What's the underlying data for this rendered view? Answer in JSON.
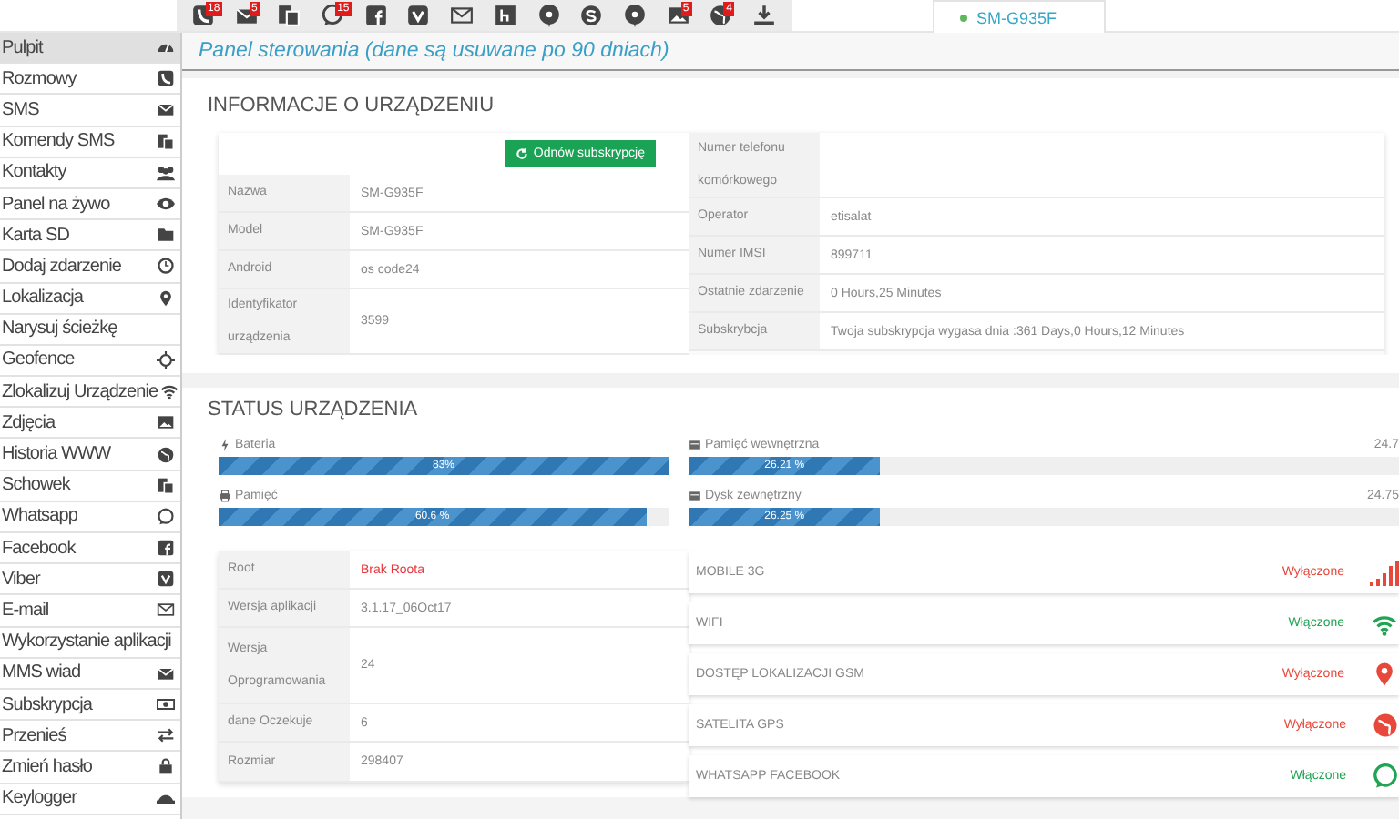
{
  "toolbar": {
    "buttons": [
      {
        "notified": true,
        "badge": "18"
      },
      {
        "notified": true,
        "badge": "5"
      },
      {
        "notified": false
      },
      {
        "notified": true,
        "badge": "15"
      },
      {
        "notified": false
      },
      {
        "notified": false
      },
      {
        "notified": false
      },
      {
        "notified": false
      },
      {
        "notified": false
      },
      {
        "notified": false
      },
      {
        "notified": false
      },
      {
        "notified": true,
        "badge": "5"
      },
      {
        "notified": true,
        "badge": "4"
      },
      {
        "notified": false
      }
    ]
  },
  "device_tab": {
    "label": "SM-G935F",
    "online": true
  },
  "sidebar": {
    "items": [
      {
        "label": "Pulpit",
        "selected": true
      },
      {
        "label": "Rozmowy",
        "selected": false
      },
      {
        "label": "SMS",
        "selected": false
      },
      {
        "label": "Komendy SMS",
        "selected": false
      },
      {
        "label": "Kontakty",
        "selected": false
      },
      {
        "label": "Panel na żywo",
        "selected": false
      },
      {
        "label": "Karta SD",
        "selected": false
      },
      {
        "label": "Dodaj zdarzenie",
        "selected": false
      },
      {
        "label": "Lokalizacja",
        "selected": false
      },
      {
        "label": "Narysuj ścieżkę",
        "selected": false
      },
      {
        "label": "Geofence",
        "selected": false
      },
      {
        "label": "Zlokalizuj Urządzenie",
        "selected": false
      },
      {
        "label": "Zdjęcia",
        "selected": false
      },
      {
        "label": "Historia WWW",
        "selected": false
      },
      {
        "label": "Schowek",
        "selected": false
      },
      {
        "label": "Whatsapp",
        "selected": false
      },
      {
        "label": "Facebook",
        "selected": false
      },
      {
        "label": "Viber",
        "selected": false
      },
      {
        "label": "E-mail",
        "selected": false
      },
      {
        "label": "Wykorzystanie aplikacji",
        "selected": false
      },
      {
        "label": "MMS wiad",
        "selected": false
      },
      {
        "label": "Subskrypcja",
        "selected": false
      },
      {
        "label": "Przenieś",
        "selected": false
      },
      {
        "label": "Zmień hasło",
        "selected": false
      },
      {
        "label": "Keylogger",
        "selected": false
      }
    ]
  },
  "header": {
    "title": "Panel sterowania (dane są usuwane po 90 dniach)"
  },
  "device_info": {
    "title": "INFORMACJE O URZĄDZENIU",
    "renew_button": "Odnów subskrypcję",
    "left_rows": [
      {
        "label": "Nazwa",
        "value": "SM-G935F"
      },
      {
        "label": "Model",
        "value": "SM-G935F"
      },
      {
        "label": "Android",
        "value": "os code24"
      },
      {
        "label": "Identyfikator urządzenia",
        "value": "3599"
      }
    ],
    "right_rows": [
      {
        "label": "Numer telefonu komórkowego",
        "value": ""
      },
      {
        "label": "Operator",
        "value": "etisalat"
      },
      {
        "label": "Numer IMSI",
        "value": "899711"
      },
      {
        "label": "Ostatnie zdarzenie",
        "value": "0 Hours,25 Minutes"
      },
      {
        "label": "Subskrybcja",
        "value": "Twoja subskrypcja wygasa dnia :361 Days,0 Hours,12 Minutes"
      }
    ]
  },
  "device_status": {
    "title": "STATUS URZĄDZENIA",
    "meters": [
      {
        "label": "Bateria",
        "bar_text": "83%",
        "level": 1.0
      },
      {
        "label": "Pamięć wewnętrzna",
        "bar_text": "26.21 %",
        "level": 0.27,
        "reading": "24.7"
      },
      {
        "label": "Pamięć",
        "bar_text": "60.6 %",
        "level": 0.95
      },
      {
        "label": "Dysk zewnętrzny",
        "bar_text": "26.25 %",
        "level": 0.27,
        "reading": "24.75"
      }
    ],
    "details": [
      {
        "label": "Root",
        "value": "Brak Roota",
        "warning": true
      },
      {
        "label": "Wersja aplikacji",
        "value": "3.1.17_06Oct17",
        "warning": false
      },
      {
        "label": "Wersja Oprogramowania",
        "value": "24",
        "warning": false
      },
      {
        "label": "dane Oczekuje",
        "value": "6",
        "warning": false
      },
      {
        "label": "Rozmiar",
        "value": "298407",
        "warning": false
      }
    ],
    "services": [
      {
        "name": "MOBILE 3G",
        "status": "Wyłączone",
        "on": false
      },
      {
        "name": "WIFI",
        "status": "Włączone",
        "on": true
      },
      {
        "name": "DOSTĘP LOKALIZACJI GSM",
        "status": "Wyłączone",
        "on": false
      },
      {
        "name": "SATELITA GPS",
        "status": "Wyłączone",
        "on": false
      },
      {
        "name": "WHATSAPP FACEBOOK",
        "status": "Włączone",
        "on": true
      }
    ]
  }
}
